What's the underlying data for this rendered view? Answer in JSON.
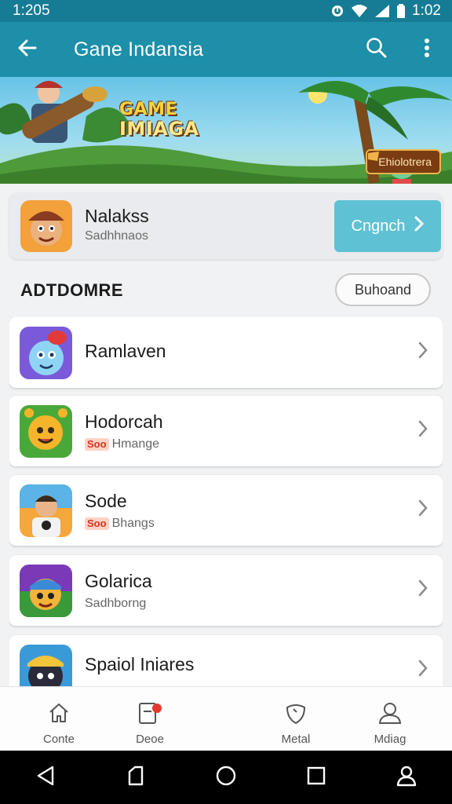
{
  "status_bar": {
    "time": "1:205",
    "right_time": "1:02"
  },
  "app_bar": {
    "title": "Gane Indansia"
  },
  "banner": {
    "title_line1": "GAME",
    "title_line2": "IMIAGA",
    "button_label": "Ehiolotrera"
  },
  "featured": {
    "name": "Nalakss",
    "subtitle": "Sadhhnaos",
    "cta_label": "Cngnch"
  },
  "section": {
    "title": "ADTDOMRE",
    "button_label": "Buhoand"
  },
  "list": [
    {
      "name": "Ramlaven",
      "tag": "",
      "subtitle": ""
    },
    {
      "name": "Hodorcah",
      "tag": "Soo",
      "subtitle": "Hmange"
    },
    {
      "name": "Sode",
      "tag": "Soo",
      "subtitle": "Bhangs"
    },
    {
      "name": "Golarica",
      "tag": "",
      "subtitle": "Sadhborng"
    },
    {
      "name": "Spaiol Iniares",
      "tag": "",
      "subtitle": ""
    }
  ],
  "bottom_nav": [
    {
      "label": "Conte",
      "icon": "home-icon"
    },
    {
      "label": "Deoe",
      "icon": "document-badge-icon"
    },
    {
      "label": "Metal",
      "icon": "shield-icon"
    },
    {
      "label": "Mdiag",
      "icon": "person-icon"
    }
  ],
  "colors": {
    "status_bar": "#167b94",
    "app_bar": "#1d8fa9",
    "cta": "#5ec2d4",
    "tag_text": "#d5311f"
  }
}
